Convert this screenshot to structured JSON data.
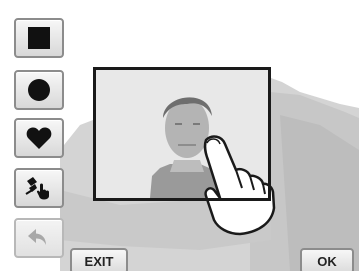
{
  "tools": [
    {
      "name": "square-shape",
      "icon": "square-icon"
    },
    {
      "name": "circle-shape",
      "icon": "circle-icon"
    },
    {
      "name": "heart-shape",
      "icon": "heart-icon"
    },
    {
      "name": "custom-touch-shape",
      "icon": "touch-draw-icon"
    },
    {
      "name": "undo",
      "icon": "undo-arrow-icon",
      "disabled": true
    }
  ],
  "footer": {
    "exit_label": "EXIT",
    "ok_label": "OK"
  },
  "colors": {
    "background": "#ffffff",
    "photo_gray": "#a9a9a9",
    "frame_border": "#1a1a1a",
    "button_border": "#8c8c8c",
    "icon_dark": "#111111"
  }
}
